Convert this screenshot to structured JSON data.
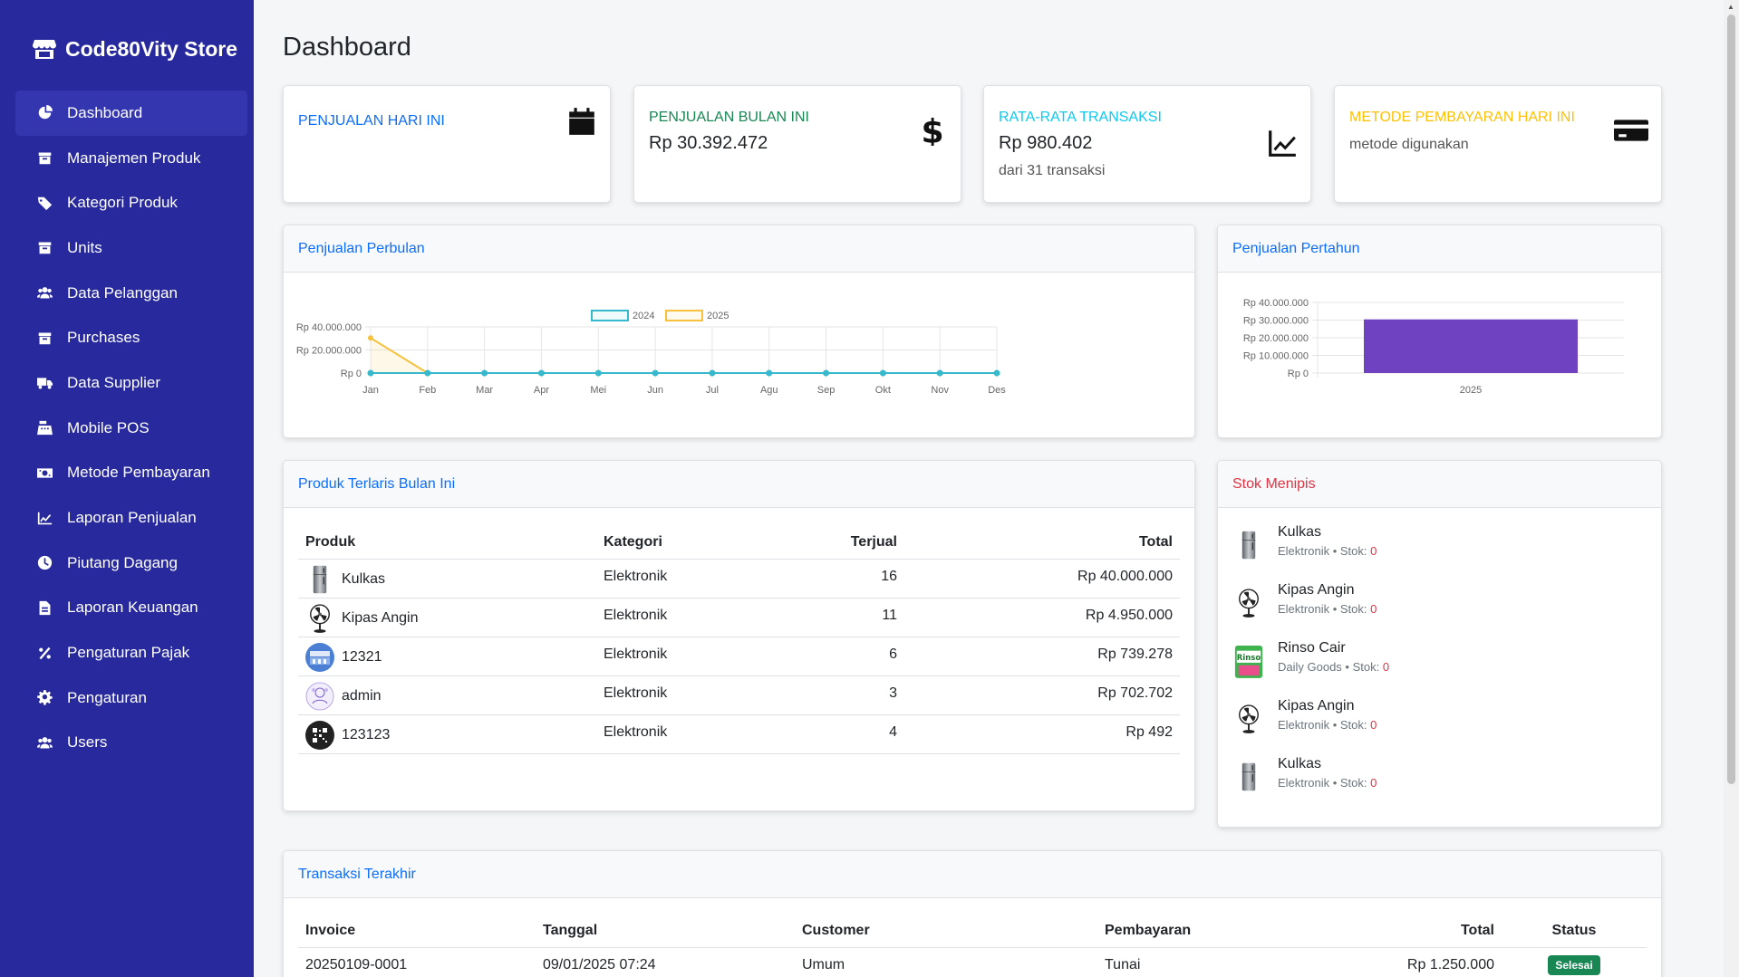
{
  "brand": {
    "name": "Code80Vity Store",
    "icon": "store-icon"
  },
  "sidebar": {
    "items": [
      {
        "label": "Dashboard",
        "icon": "dashboard-icon",
        "active": true
      },
      {
        "label": "Manajemen Produk",
        "icon": "box-icon"
      },
      {
        "label": "Kategori Produk",
        "icon": "tag-icon"
      },
      {
        "label": "Units",
        "icon": "box-icon"
      },
      {
        "label": "Data Pelanggan",
        "icon": "users-icon"
      },
      {
        "label": "Purchases",
        "icon": "box-icon"
      },
      {
        "label": "Data Supplier",
        "icon": "truck-icon"
      },
      {
        "label": "Mobile POS",
        "icon": "cash-register-icon"
      },
      {
        "label": "Metode Pembayaran",
        "icon": "money-icon"
      },
      {
        "label": "Laporan Penjualan",
        "icon": "chart-icon"
      },
      {
        "label": "Piutang Dagang",
        "icon": "clock-icon"
      },
      {
        "label": "Laporan Keuangan",
        "icon": "file-icon"
      },
      {
        "label": "Pengaturan Pajak",
        "icon": "percent-icon"
      },
      {
        "label": "Pengaturan",
        "icon": "gear-icon"
      },
      {
        "label": "Users",
        "icon": "users-icon"
      }
    ]
  },
  "page": {
    "title": "Dashboard"
  },
  "stats": [
    {
      "label": "PENJUALAN HARI INI",
      "value": "",
      "sub": "",
      "color": "#0d6efd",
      "icon": "calendar-icon"
    },
    {
      "label": "PENJUALAN BULAN INI",
      "value": "Rp 30.392.472",
      "sub": "",
      "color": "#198754",
      "icon": "dollar-icon"
    },
    {
      "label": "RATA-RATA TRANSAKSI",
      "value": "Rp 980.402",
      "sub": "dari 31 transaksi",
      "color": "#0dcaf0",
      "icon": "chart-line-icon"
    },
    {
      "label": "METODE PEMBAYARAN HARI INI",
      "value": "",
      "sub": "metode digunakan",
      "color": "#ffc107",
      "icon": "credit-card-icon"
    }
  ],
  "monthly": {
    "title": "Penjualan Perbulan",
    "legend": [
      "2024",
      "2025"
    ],
    "colors": {
      "s2024": "#36b9cc",
      "s2025": "#f6c23e"
    }
  },
  "yearly": {
    "title": "Penjualan Pertahun",
    "color": "#6f42c1"
  },
  "chart_data": [
    {
      "type": "line",
      "title": "Penjualan Perbulan",
      "categories": [
        "Jan",
        "Feb",
        "Mar",
        "Apr",
        "Mei",
        "Jun",
        "Jul",
        "Agu",
        "Sep",
        "Okt",
        "Nov",
        "Des"
      ],
      "yticks": [
        "Rp 40.000.000",
        "Rp 20.000.000",
        "Rp 0"
      ],
      "ylim": [
        0,
        45000000
      ],
      "series": [
        {
          "name": "2024",
          "values": [
            0,
            0,
            0,
            0,
            0,
            0,
            0,
            0,
            0,
            0,
            0,
            0
          ]
        },
        {
          "name": "2025",
          "values": [
            30392472,
            0,
            0,
            0,
            0,
            0,
            0,
            0,
            0,
            0,
            0,
            0
          ]
        }
      ],
      "legend": "top-center",
      "grid": true
    },
    {
      "type": "bar",
      "title": "Penjualan Pertahun",
      "categories": [
        "2025"
      ],
      "values": [
        30392472
      ],
      "yticks": [
        "Rp 40.000.000",
        "Rp 30.000.000",
        "Rp 20.000.000",
        "Rp 10.000.000",
        "Rp 0"
      ],
      "ylim": [
        0,
        40000000
      ],
      "grid": true
    }
  ],
  "top_products": {
    "title": "Produk Terlaris Bulan Ini",
    "headers": [
      "Produk",
      "Kategori",
      "Terjual",
      "Total"
    ],
    "rows": [
      {
        "name": "Kulkas",
        "category": "Elektronik",
        "sold": "16",
        "total": "Rp 40.000.000",
        "thumb": "fridge-icon"
      },
      {
        "name": "Kipas Angin",
        "category": "Elektronik",
        "sold": "11",
        "total": "Rp 4.950.000",
        "thumb": "fan-icon"
      },
      {
        "name": "12321",
        "category": "Elektronik",
        "sold": "6",
        "total": "Rp 739.278",
        "thumb": "store-photo-icon"
      },
      {
        "name": "admin",
        "category": "Elektronik",
        "sold": "3",
        "total": "Rp 702.702",
        "thumb": "pattern-icon"
      },
      {
        "name": "123123",
        "category": "Elektronik",
        "sold": "4",
        "total": "Rp 492",
        "thumb": "qr-icon"
      }
    ]
  },
  "low_stock": {
    "title": "Stok Menipis",
    "items": [
      {
        "name": "Kulkas",
        "category": "Elektronik",
        "stock_label": "Stok:",
        "stock": "0",
        "thumb": "fridge-icon"
      },
      {
        "name": "Kipas Angin",
        "category": "Elektronik",
        "stock_label": "Stok:",
        "stock": "0",
        "thumb": "fan-icon"
      },
      {
        "name": "Rinso Cair",
        "category": "Daily Goods",
        "stock_label": "Stok:",
        "stock": "0",
        "thumb": "detergent-icon"
      },
      {
        "name": "Kipas Angin",
        "category": "Elektronik",
        "stock_label": "Stok:",
        "stock": "0",
        "thumb": "fan-icon"
      },
      {
        "name": "Kulkas",
        "category": "Elektronik",
        "stock_label": "Stok:",
        "stock": "0",
        "thumb": "fridge-icon"
      }
    ]
  },
  "transactions": {
    "title": "Transaksi Terakhir",
    "headers": [
      "Invoice",
      "Tanggal",
      "Customer",
      "Pembayaran",
      "Total",
      "Status"
    ],
    "rows": [
      {
        "invoice": "20250109-0001",
        "date": "09/01/2025 07:24",
        "customer": "Umum",
        "payment": "Tunai",
        "total": "Rp 1.250.000",
        "status": "Selesai"
      }
    ]
  }
}
